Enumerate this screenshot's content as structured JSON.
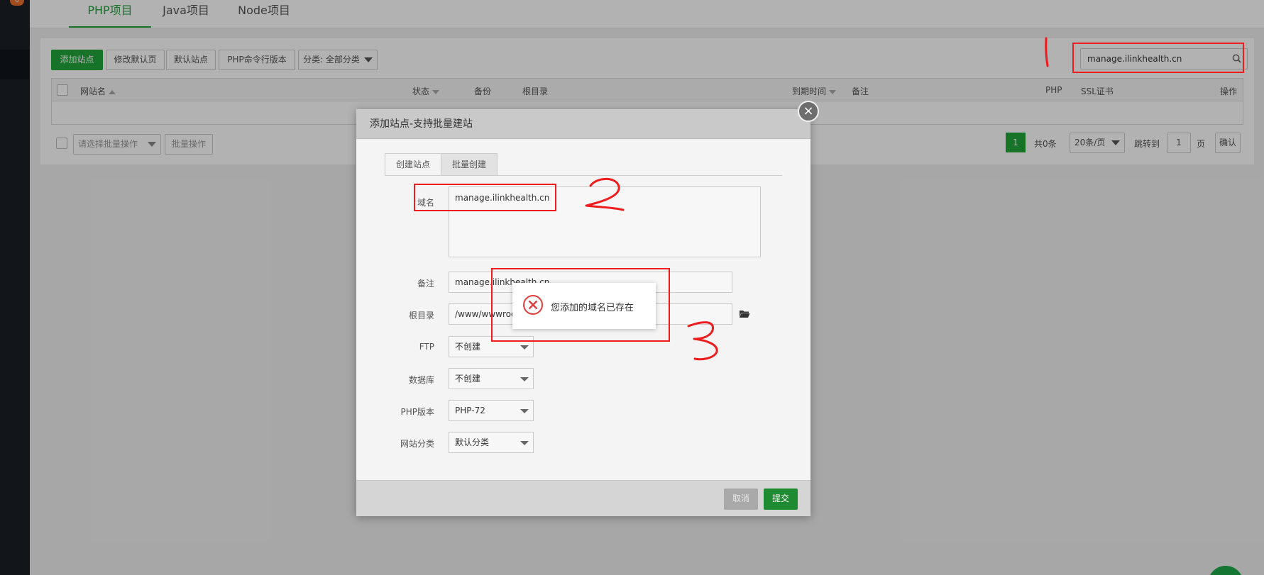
{
  "sidebar": {
    "badge": "6"
  },
  "tabs": [
    "PHP项目",
    "Java项目",
    "Node项目"
  ],
  "toolbar": {
    "add_site": "添加站点",
    "edit_default_page": "修改默认页",
    "default_site": "默认站点",
    "php_cli_version": "PHP命令行版本",
    "category": "分类: 全部分类"
  },
  "search": {
    "value": "manage.ilinkhealth.cn"
  },
  "table": {
    "headers": {
      "name": "网站名",
      "status": "状态",
      "backup": "备份",
      "root": "根目录",
      "expire": "到期时间",
      "remark": "备注",
      "php": "PHP",
      "ssl": "SSL证书",
      "action": "操作"
    }
  },
  "batch": {
    "placeholder": "请选择批量操作",
    "button": "批量操作"
  },
  "pager": {
    "current": "1",
    "total": "共0条",
    "per_page": "20条/页",
    "jump_label": "跳转到",
    "jump_value": "1",
    "page_unit": "页",
    "confirm": "确认"
  },
  "modal": {
    "title": "添加站点-支持批量建站",
    "close": "×",
    "tabs": [
      "创建站点",
      "批量创建"
    ],
    "fields": {
      "domain": {
        "label": "域名",
        "value": "manage.ilinkhealth.cn"
      },
      "remark": {
        "label": "备注",
        "value": "manage.ilinkhealth.cn"
      },
      "root": {
        "label": "根目录",
        "value": "/www/wwwroot/manage.ilinkhealth.cn"
      },
      "ftp": {
        "label": "FTP",
        "value": "不创建"
      },
      "database": {
        "label": "数据库",
        "value": "不创建"
      },
      "php_version": {
        "label": "PHP版本",
        "value": "PHP-72"
      },
      "site_category": {
        "label": "网站分类",
        "value": "默认分类"
      }
    },
    "cancel": "取消",
    "submit": "提交"
  },
  "toast": {
    "message": "您添加的域名已存在",
    "icon": "error-circle-icon"
  },
  "colors": {
    "accent": "#20a53a",
    "annotation": "#ee1c1c"
  }
}
